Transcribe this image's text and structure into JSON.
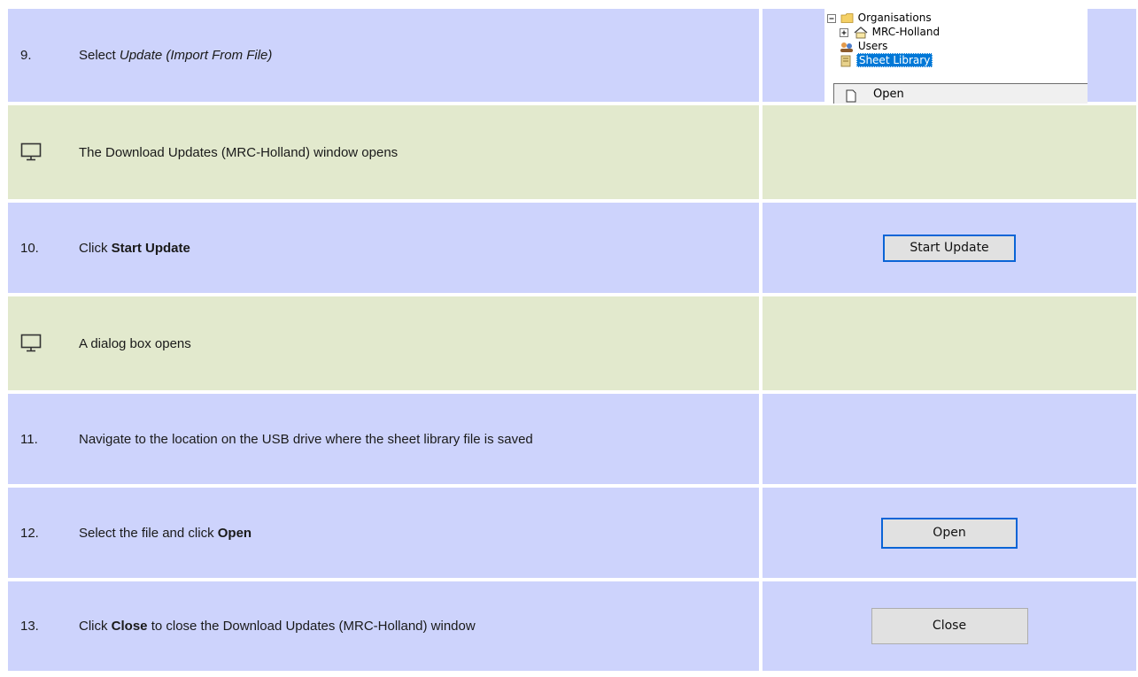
{
  "steps": [
    {
      "type": "action",
      "number": "9.",
      "pre": "Select ",
      "em": "Update (Import From File)",
      "post": ""
    },
    {
      "type": "result",
      "icon": "monitor-icon",
      "text": "The Download Updates (MRC-Holland) window opens"
    },
    {
      "type": "action",
      "number": "10.",
      "pre": "Click ",
      "bold": "Start Update",
      "post": ""
    },
    {
      "type": "result",
      "icon": "monitor-icon",
      "text": "A dialog box opens"
    },
    {
      "type": "action",
      "number": "11.",
      "text": "Navigate to the location on the USB drive where the sheet library file is saved"
    },
    {
      "type": "action",
      "number": "12.",
      "pre": "Select the file and click ",
      "bold": "Open",
      "post": ""
    },
    {
      "type": "action",
      "number": "13.",
      "pre": "Click ",
      "bold": "Close",
      "post": " to close the Download Updates (MRC-Holland) window"
    }
  ],
  "tree": {
    "organisations": "Organisations",
    "mrc_holland": "MRC-Holland",
    "users": "Users",
    "sheet_library": "Sheet Library",
    "context_open": "Open"
  },
  "buttons": {
    "start_update": "Start Update",
    "open": "Open",
    "close": "Close"
  },
  "colors": {
    "action_row": "#cdd3fc",
    "result_row": "#e2e9cd",
    "focus_border": "#0a64d6",
    "selection": "#0078d7"
  }
}
